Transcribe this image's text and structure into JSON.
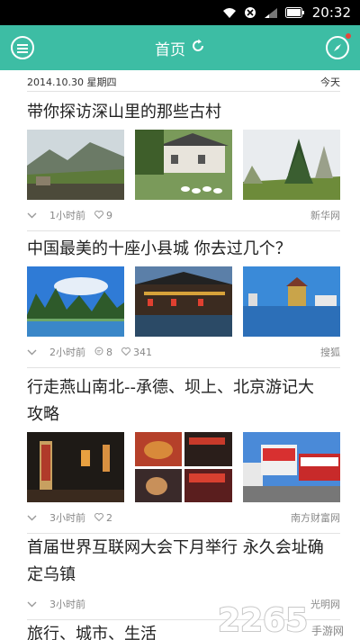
{
  "status": {
    "time": "20:32"
  },
  "header": {
    "title": "首页"
  },
  "date_row": {
    "date": "2014.10.30 星期四",
    "today": "今天"
  },
  "articles": [
    {
      "title": "带你探访深山里的那些古村",
      "time": "1小时前",
      "likes": "9",
      "source": "新华网"
    },
    {
      "title": "中国最美的十座小县城 你去过几个？",
      "time": "2小时前",
      "comments": "8",
      "likes": "341",
      "source": "搜狐"
    },
    {
      "title_line1": "行走燕山南北--承德、坝上、北京游记大",
      "title_line2": "攻略",
      "time": "3小时前",
      "likes": "2",
      "source": "南方财富网"
    },
    {
      "title_line1": "首届世界互联网大会下月举行 永久会址确",
      "title_line2": "定乌镇",
      "time": "3小时前",
      "source": "光明网"
    },
    {
      "title": "旅行、城市、生活"
    }
  ],
  "watermark": {
    "brand": "2265",
    "sub": "手游网"
  },
  "colors": {
    "accent": "#3dbda4",
    "notice": "#e8453c"
  }
}
